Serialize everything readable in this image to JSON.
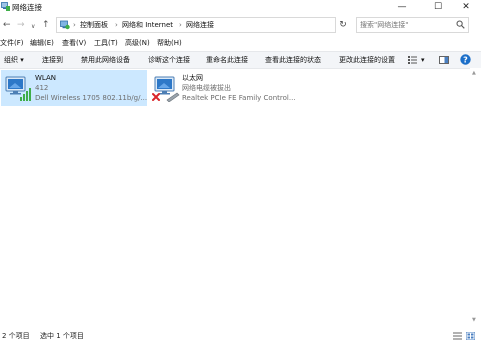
{
  "window": {
    "title": "网络连接",
    "minimize_glyph": "—",
    "maximize_glyph": "☐",
    "close_glyph": "✕"
  },
  "navigation": {
    "back_glyph": "←",
    "forward_glyph": "→",
    "recent_glyph": "∨",
    "up_glyph": "↑",
    "refresh_glyph": "↻",
    "dropdown_glyph": "∨"
  },
  "breadcrumb": {
    "separator": "›",
    "items": [
      "控制面板",
      "网络和 Internet",
      "网络连接"
    ]
  },
  "search": {
    "placeholder": "搜索\"网络连接\""
  },
  "menubar": {
    "items": [
      "文件(F)",
      "编辑(E)",
      "查看(V)",
      "工具(T)",
      "高级(N)",
      "帮助(H)"
    ]
  },
  "toolbar": {
    "organize_label": "组织 ▾",
    "connect_to_label": "连接到",
    "disable_label": "禁用此网络设备",
    "diagnose_label": "诊断这个连接",
    "rename_label": "重命名此连接",
    "view_status_label": "查看此连接的状态",
    "change_settings_label": "更改此连接的设置",
    "view_dropdown_glyph": "▾",
    "help_glyph": "?"
  },
  "connections": [
    {
      "name": "WLAN",
      "status": "412",
      "adapter": "Dell Wireless 1705 802.11b/g/...",
      "icon": "wifi-adapter-icon",
      "selected": true
    },
    {
      "name": "以太网",
      "status": "网络电缆被拔出",
      "adapter": "Realtek PCIe FE Family Control...",
      "icon": "ethernet-adapter-icon",
      "selected": false
    }
  ],
  "statusbar": {
    "item_count": "2 个项目",
    "selected_count": "选中 1 个项目"
  },
  "colors": {
    "selection": "#cce8ff",
    "command_bar": "#f3f5f8",
    "accent": "#0078d7",
    "signal_green": "#3fae49",
    "error_red": "#d9262b",
    "muted_text": "#6d6d6d"
  }
}
